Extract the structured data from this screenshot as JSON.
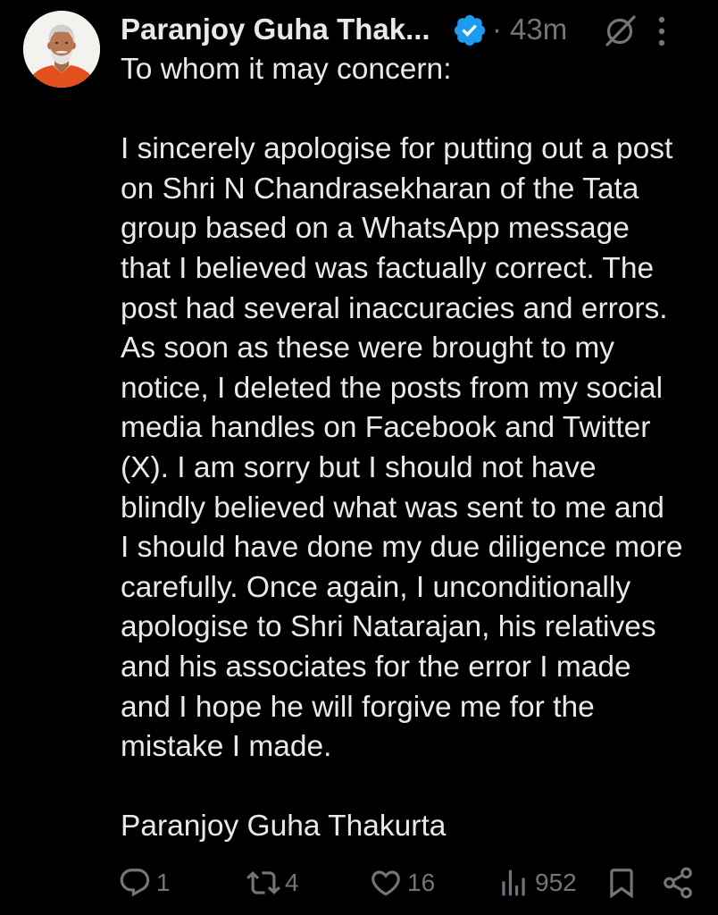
{
  "colors": {
    "background": "#000000",
    "text": "#e7e9ea",
    "muted": "#71767b",
    "verified": "#1d9bf0"
  },
  "post": {
    "author": {
      "display_name": "Paranjoy Guha Thak...",
      "verified_badge_icon": "verified-badge-icon"
    },
    "separator": "·",
    "time": "43m",
    "header_icons": {
      "grok": "grok-icon",
      "more": "more-options-icon"
    },
    "greeting": "To whom it may concern:",
    "paragraph_lines": [
      "I sincerely apologise for putting out a post",
      "on Shri N Chandrasekharan of the Tata",
      "group based on a WhatsApp message",
      "that I believed was factually correct. The",
      "post had several inaccuracies and errors.",
      "As soon as these were brought to my",
      "notice, I deleted the posts from my social",
      "media handles on Facebook and Twitter",
      "(X). I am sorry but I should not have",
      "blindly believed what was sent to me and",
      "I should have done my due diligence more",
      "carefully. Once again, I unconditionally",
      "apologise to Shri Natarajan, his relatives",
      "and his associates for the error I made",
      "and I hope he will forgive me for the",
      "mistake I made."
    ],
    "signature": "Paranjoy Guha Thakurta"
  },
  "actions": {
    "reply": {
      "icon": "reply-icon",
      "count": "1"
    },
    "repost": {
      "icon": "repost-icon",
      "count": "4"
    },
    "like": {
      "icon": "heart-icon",
      "count": "16"
    },
    "views": {
      "icon": "views-icon",
      "count": "952"
    },
    "bookmark": {
      "icon": "bookmark-icon"
    },
    "share": {
      "icon": "share-icon"
    }
  }
}
